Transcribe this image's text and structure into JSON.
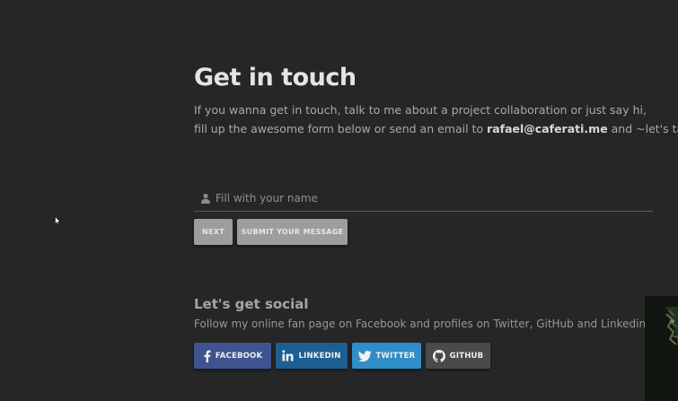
{
  "header": {
    "title": "Get in touch",
    "intro_line1": "If you wanna get in touch, talk to me about a project collaboration or just say hi,",
    "intro_line2_pre": "fill up the awesome form below or send an email to ",
    "email": "rafael@caferati.me",
    "intro_line2_post": " and ~let's talk."
  },
  "form": {
    "name_placeholder": "Fill with your name",
    "name_value": "",
    "next_label": "NEXT",
    "submit_label": "SUBMIT YOUR MESSAGE"
  },
  "social": {
    "title": "Let's get social",
    "text": "Follow my online fan page on Facebook and profiles on Twitter, GitHub and Linkedin.",
    "buttons": [
      {
        "label": "FACEBOOK",
        "icon": "facebook-icon",
        "color": "#3e5390"
      },
      {
        "label": "LINKEDIN",
        "icon": "linkedin-icon",
        "color": "#1c5f92"
      },
      {
        "label": "TWITTER",
        "icon": "twitter-icon",
        "color": "#2f8dc7"
      },
      {
        "label": "GITHUB",
        "icon": "github-icon",
        "color": "#4a4a4a"
      }
    ]
  },
  "colors": {
    "background": "#262626",
    "title": "#e4e4e4",
    "button_disabled": "#9d9d9d"
  }
}
